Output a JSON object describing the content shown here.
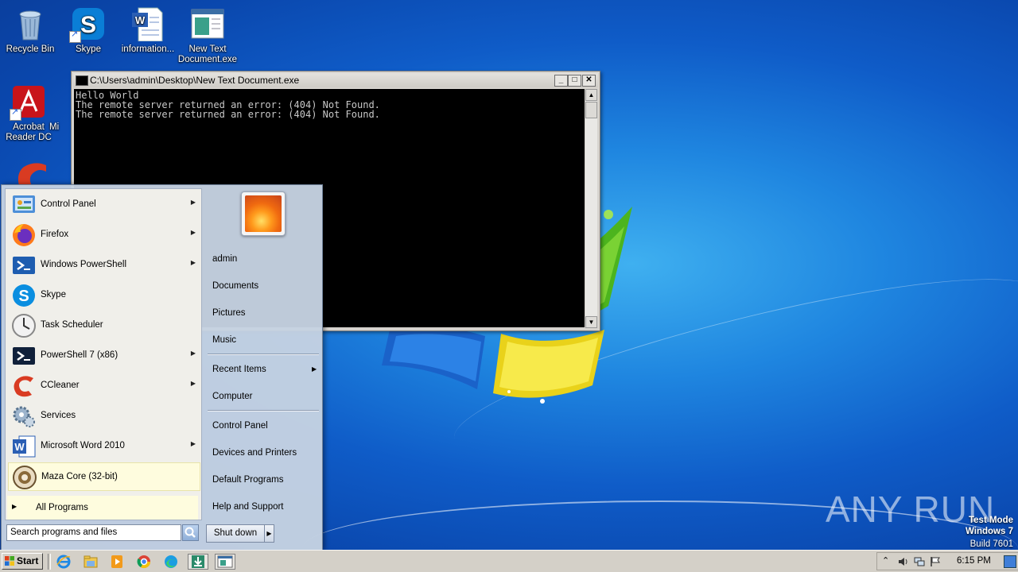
{
  "desktop": {
    "icons": [
      {
        "label": "Recycle Bin"
      },
      {
        "label": "Skype"
      },
      {
        "label": "information..."
      },
      {
        "label": "New Text Document.exe"
      },
      {
        "label": "Acrobat Reader DC"
      },
      {
        "label": "Mi"
      }
    ]
  },
  "console": {
    "title": "C:\\Users\\admin\\Desktop\\New Text Document.exe",
    "lines": [
      "Hello World",
      "The remote server returned an error: (404) Not Found.",
      "The remote server returned an error: (404) Not Found."
    ]
  },
  "start_menu": {
    "programs": [
      {
        "label": "Control Panel",
        "submenu": true
      },
      {
        "label": "Firefox",
        "submenu": true
      },
      {
        "label": "Windows PowerShell",
        "submenu": true
      },
      {
        "label": "Skype",
        "submenu": false
      },
      {
        "label": "Task Scheduler",
        "submenu": false
      },
      {
        "label": "PowerShell 7 (x86)",
        "submenu": true
      },
      {
        "label": "CCleaner",
        "submenu": true
      },
      {
        "label": "Services",
        "submenu": false
      },
      {
        "label": "Microsoft Word 2010",
        "submenu": true
      },
      {
        "label": "Maza Core (32-bit)",
        "submenu": false
      }
    ],
    "all_programs": "All Programs",
    "search_placeholder": "Search programs and files",
    "right": {
      "user": "admin",
      "documents": "Documents",
      "pictures": "Pictures",
      "music": "Music",
      "recent_items": "Recent Items",
      "computer": "Computer",
      "control_panel": "Control Panel",
      "devices_printers": "Devices and Printers",
      "default_programs": "Default Programs",
      "help_support": "Help and Support"
    },
    "shutdown": "Shut down"
  },
  "taskbar": {
    "start": "Start",
    "clock": "6:15 PM"
  },
  "watermark": {
    "brand": "ANY RUN",
    "mode": "Test Mode",
    "os": "Windows 7",
    "build": "Build 7601"
  }
}
